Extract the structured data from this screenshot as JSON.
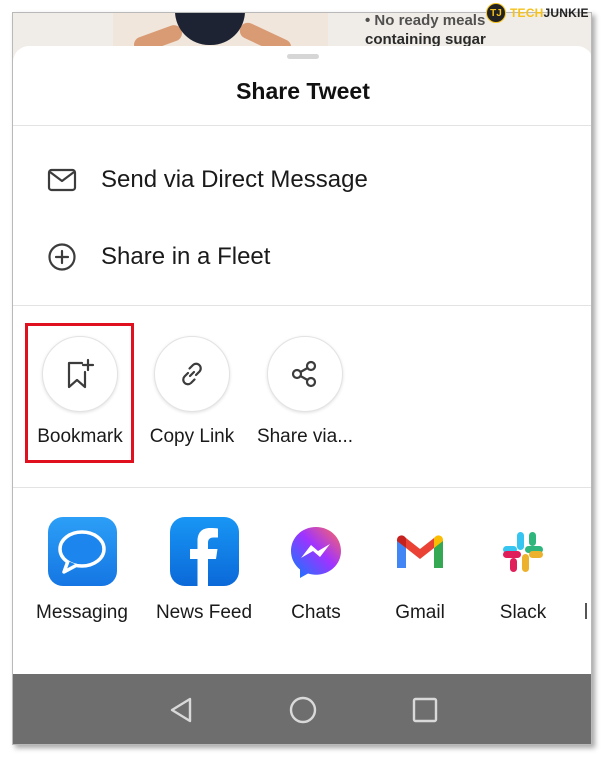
{
  "background_app": {
    "text_line1": "• No ready meals",
    "text_line2": "containing sugar"
  },
  "watermark": {
    "logo_text": "TJ",
    "brand_part1": "TECH",
    "brand_part2": "JUNKIE"
  },
  "sheet": {
    "title": "Share Tweet",
    "rows": [
      {
        "label": "Send via Direct Message",
        "icon": "envelope-icon"
      },
      {
        "label": "Share in a Fleet",
        "icon": "plus-circle-icon"
      }
    ],
    "actions": [
      {
        "label": "Bookmark",
        "icon": "bookmark-add-icon"
      },
      {
        "label": "Copy Link",
        "icon": "link-icon"
      },
      {
        "label": "Share via...",
        "icon": "share-icon"
      }
    ],
    "apps": [
      {
        "label": "Messaging",
        "icon": "messaging-icon"
      },
      {
        "label": "News Feed",
        "icon": "facebook-icon"
      },
      {
        "label": "Chats",
        "icon": "messenger-icon"
      },
      {
        "label": "Gmail",
        "icon": "gmail-icon"
      },
      {
        "label": "Slack",
        "icon": "slack-icon"
      }
    ]
  },
  "navbar": {
    "buttons": [
      "back-icon",
      "home-icon",
      "recents-icon"
    ]
  },
  "colors": {
    "highlight": "#e0101f",
    "navbar": "#6e6e6e",
    "messaging": "#1d86ee",
    "facebook": "#1877f2",
    "messenger_from": "#0a7cff",
    "messenger_to": "#ff6a5c",
    "gmail_red": "#ea4335",
    "slack_purple": "#4a154b"
  }
}
